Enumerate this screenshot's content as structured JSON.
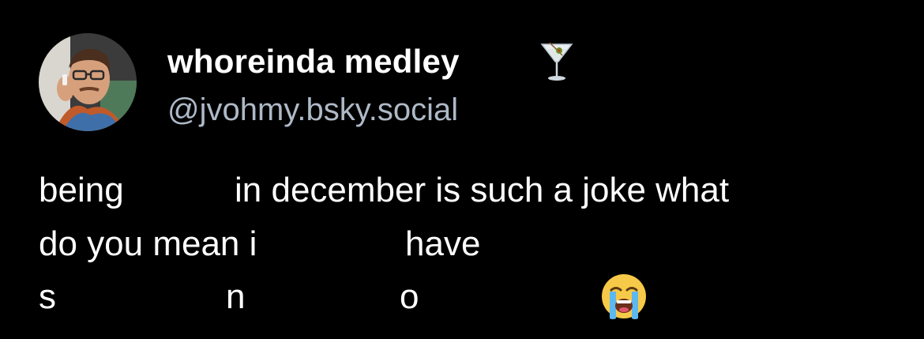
{
  "author": {
    "display_name": "whoreinda medley",
    "name_emoji": "cocktail-glass-emoji",
    "handle": "@jvohmy.bsky.social",
    "avatar": "profile-photo-avatar"
  },
  "post": {
    "line1": {
      "part1": "being",
      "part2": "in december is such a joke what"
    },
    "line2": {
      "part1": "do you mean i",
      "part2": "have"
    },
    "line3": {
      "letter_s": "s",
      "letter_n": "n",
      "letter_o": "o",
      "emoji": "loudly-crying-face-emoji"
    }
  },
  "colors": {
    "background": "#000000",
    "text": "#ffffff",
    "handle": "#aeb9c7"
  }
}
